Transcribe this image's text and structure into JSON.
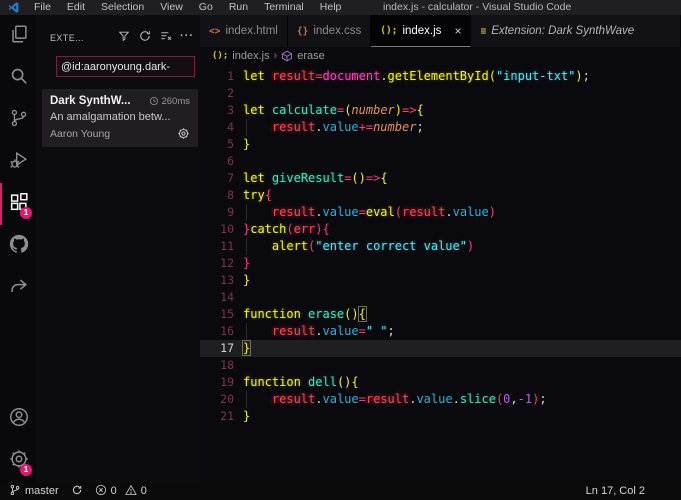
{
  "title_bar": {
    "menus": [
      "File",
      "Edit",
      "Selection",
      "View",
      "Go",
      "Run",
      "Terminal",
      "Help"
    ],
    "title": "index.js - calculator - Visual Studio Code"
  },
  "activity_bar": {
    "top": [
      {
        "name": "explorer",
        "active": false,
        "badge": ""
      },
      {
        "name": "search",
        "active": false,
        "badge": ""
      },
      {
        "name": "source-control",
        "active": false,
        "badge": ""
      },
      {
        "name": "run-debug",
        "active": false,
        "badge": ""
      },
      {
        "name": "extensions",
        "active": true,
        "badge": "1"
      },
      {
        "name": "github",
        "active": false,
        "badge": ""
      },
      {
        "name": "remote-explorer",
        "active": false,
        "badge": ""
      }
    ],
    "bottom": [
      {
        "name": "account",
        "active": false,
        "badge": ""
      },
      {
        "name": "settings",
        "active": false,
        "badge": "1"
      }
    ]
  },
  "sidebar": {
    "header_title": "EXTE...",
    "header_actions": [
      "filter",
      "refresh",
      "clear-all",
      "more"
    ],
    "search_value": "@id:aaronyoung.dark-",
    "extension": {
      "name": "Dark SynthW...",
      "load_time": "260ms",
      "description": "An amalgamation betw...",
      "author": "Aaron Young"
    }
  },
  "tabs": [
    {
      "id": "index-html",
      "icon": "html-file-icon",
      "glyph": "<>",
      "glyph_color": "#d2703c",
      "label": "index.html",
      "active": false,
      "close": false,
      "italic": false
    },
    {
      "id": "index-css",
      "icon": "css-file-icon",
      "glyph": "{}",
      "glyph_color": "#d2703c",
      "label": "index.css",
      "active": false,
      "close": false,
      "italic": false
    },
    {
      "id": "index-js",
      "icon": "js-file-icon",
      "glyph": "();",
      "glyph_color": "#d8c82e",
      "label": "index.js",
      "active": true,
      "close": true,
      "italic": false
    },
    {
      "id": "extension-dark-synthwave",
      "icon": "extension-icon",
      "glyph": "≡",
      "glyph_color": "#c9b42f",
      "label": "Extension: Dark SynthWave",
      "active": false,
      "close": false,
      "italic": true
    }
  ],
  "breadcrumb": {
    "file": "index.js",
    "separator": "›",
    "symbol": "erase"
  },
  "editor": {
    "active_line": 17,
    "lines": [
      {
        "n": 1,
        "tokens": [
          [
            "kw",
            "let"
          ],
          [
            "pl",
            " "
          ],
          [
            "var",
            "result"
          ],
          [
            "op",
            "="
          ],
          [
            "obj",
            "document"
          ],
          [
            "pun",
            "."
          ],
          [
            "kw",
            "getElementById"
          ],
          [
            "b0",
            "("
          ],
          [
            "str",
            "\"input-txt\""
          ],
          [
            "b0",
            ")"
          ],
          [
            "pun",
            ";"
          ]
        ]
      },
      {
        "n": 2,
        "tokens": []
      },
      {
        "n": 3,
        "tokens": [
          [
            "kw",
            "let"
          ],
          [
            "pl",
            " "
          ],
          [
            "fn",
            "calculate"
          ],
          [
            "op",
            "="
          ],
          [
            "b0",
            "("
          ],
          [
            "param",
            "number"
          ],
          [
            "b0",
            ")"
          ],
          [
            "op",
            "=>"
          ],
          [
            "b0",
            "{"
          ]
        ]
      },
      {
        "n": 4,
        "guide": true,
        "tokens": [
          [
            "pl",
            "    "
          ],
          [
            "var",
            "result"
          ],
          [
            "pun",
            "."
          ],
          [
            "prop",
            "value"
          ],
          [
            "op",
            "+="
          ],
          [
            "param",
            "number"
          ],
          [
            "pun",
            ";"
          ]
        ]
      },
      {
        "n": 5,
        "tokens": [
          [
            "b0",
            "}"
          ]
        ]
      },
      {
        "n": 6,
        "tokens": []
      },
      {
        "n": 7,
        "tokens": [
          [
            "kw",
            "let"
          ],
          [
            "pl",
            " "
          ],
          [
            "fn",
            "giveResult"
          ],
          [
            "op",
            "="
          ],
          [
            "b0",
            "("
          ],
          [
            "b0",
            ")"
          ],
          [
            "op",
            "=>"
          ],
          [
            "b0",
            "{"
          ]
        ]
      },
      {
        "n": 8,
        "tokens": [
          [
            "kw",
            "try"
          ],
          [
            "b1",
            "{"
          ]
        ]
      },
      {
        "n": 9,
        "guide": true,
        "tokens": [
          [
            "pl",
            "    "
          ],
          [
            "var",
            "result"
          ],
          [
            "pun",
            "."
          ],
          [
            "prop",
            "value"
          ],
          [
            "op",
            "="
          ],
          [
            "kw",
            "eval"
          ],
          [
            "b1",
            "("
          ],
          [
            "var",
            "result"
          ],
          [
            "pun",
            "."
          ],
          [
            "prop",
            "value"
          ],
          [
            "b1",
            ")"
          ]
        ]
      },
      {
        "n": 10,
        "tokens": [
          [
            "b1",
            "}"
          ],
          [
            "kw",
            "catch"
          ],
          [
            "b1",
            "("
          ],
          [
            "var",
            "err"
          ],
          [
            "b1",
            ")"
          ],
          [
            "b1",
            "{"
          ]
        ]
      },
      {
        "n": 11,
        "guide": true,
        "tokens": [
          [
            "pl",
            "    "
          ],
          [
            "kw",
            "alert"
          ],
          [
            "b1",
            "("
          ],
          [
            "str",
            "\"enter correct value\""
          ],
          [
            "b1",
            ")"
          ]
        ]
      },
      {
        "n": 12,
        "tokens": [
          [
            "b1",
            "}"
          ]
        ]
      },
      {
        "n": 13,
        "tokens": [
          [
            "b0",
            "}"
          ]
        ]
      },
      {
        "n": 14,
        "tokens": []
      },
      {
        "n": 15,
        "tokens": [
          [
            "kw",
            "function"
          ],
          [
            "pl",
            " "
          ],
          [
            "fn",
            "erase"
          ],
          [
            "b0",
            "("
          ],
          [
            "b0",
            ")"
          ],
          [
            "bm",
            "{"
          ]
        ]
      },
      {
        "n": 16,
        "guide": true,
        "tokens": [
          [
            "pl",
            "    "
          ],
          [
            "var",
            "result"
          ],
          [
            "pun",
            "."
          ],
          [
            "prop",
            "value"
          ],
          [
            "op",
            "="
          ],
          [
            "str",
            "\" \""
          ],
          [
            "pun",
            ";"
          ]
        ]
      },
      {
        "n": 17,
        "cursor": true,
        "tokens": [
          [
            "bm",
            "}"
          ]
        ]
      },
      {
        "n": 18,
        "tokens": []
      },
      {
        "n": 19,
        "tokens": [
          [
            "kw",
            "function"
          ],
          [
            "pl",
            " "
          ],
          [
            "fn",
            "dell"
          ],
          [
            "b0",
            "("
          ],
          [
            "b0",
            ")"
          ],
          [
            "b0",
            "{"
          ]
        ]
      },
      {
        "n": 20,
        "guide": true,
        "tokens": [
          [
            "pl",
            "    "
          ],
          [
            "var",
            "result"
          ],
          [
            "pun",
            "."
          ],
          [
            "prop",
            "value"
          ],
          [
            "op",
            "="
          ],
          [
            "var",
            "result"
          ],
          [
            "pun",
            "."
          ],
          [
            "prop",
            "value"
          ],
          [
            "pun",
            "."
          ],
          [
            "fn",
            "slice"
          ],
          [
            "b1",
            "("
          ],
          [
            "num",
            "0"
          ],
          [
            "pun",
            ","
          ],
          [
            "num",
            "-1"
          ],
          [
            "b1",
            ")"
          ],
          [
            "pun",
            ";"
          ]
        ]
      },
      {
        "n": 21,
        "tokens": [
          [
            "b0",
            "}"
          ]
        ]
      }
    ]
  },
  "status_bar": {
    "branch_label": "master",
    "error_count": "0",
    "warning_count": "0",
    "cursor_position": "Ln 17, Col 2"
  },
  "colors": {
    "accent_pink": "#e4186e",
    "keyword_yellow": "#f6f61d",
    "string_cyan": "#5ae6f7",
    "variable_red": "#fe4450",
    "object_magenta": "#fa3fb4",
    "property_blue": "#1fb6e6",
    "function_teal": "#3ce8c0",
    "number_purple": "#b267e6",
    "operator_pink": "#fd3b7d",
    "line_number_maroon": "#7a3748",
    "search_border_crimson": "#7d1f3c"
  }
}
